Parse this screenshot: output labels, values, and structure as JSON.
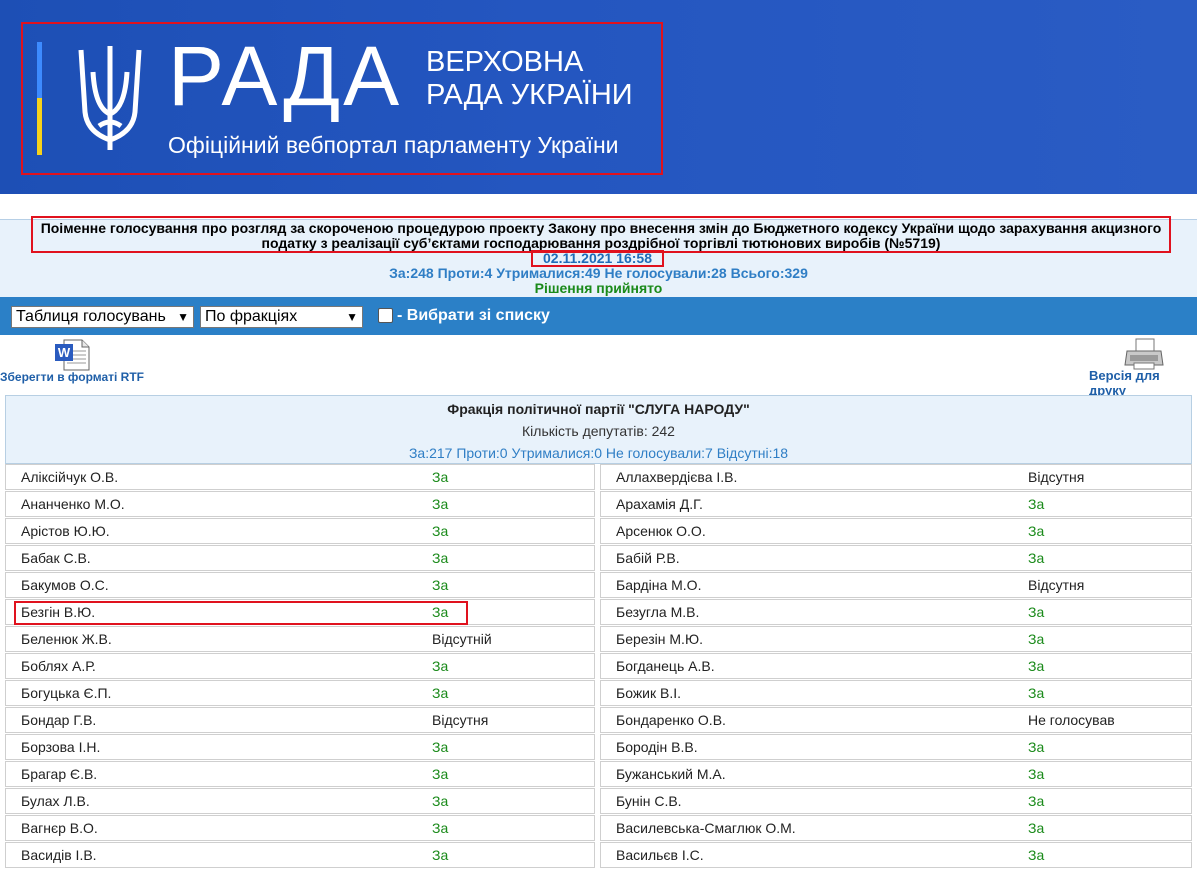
{
  "header": {
    "logo_word": "РАДА",
    "org_line1": "ВЕРХОВНА",
    "org_line2": "РАДА УКРАЇНИ",
    "portal_title": "Офіційний вебпортал парламенту України"
  },
  "vote": {
    "title": "Поіменне голосування про розгляд за скороченою процедурою проекту Закону про внесення змін до Бюджетного кодексу України щодо зарахування акцизного податку з реалізації суб’єктами господарювання роздрібної торгівлі тютюнових виробів (№5719)",
    "datetime": "02.11.2021 16:58",
    "summary": "За:248 Проти:4 Утрималися:49 Не голосували:28 Всього:329",
    "decision": "Рішення прийнято"
  },
  "toolbar": {
    "view_select": "Таблиця голосувань",
    "group_select": "По фракціях",
    "choose_label": "- Вибрати зі списку"
  },
  "actions": {
    "rtf_label": "Зберегти в форматі RTF",
    "print_label": "Версія для друку"
  },
  "faction": {
    "name": "Фракція політичної партії \"СЛУГА НАРОДУ\"",
    "count": "Кількість депутатів: 242",
    "summary": "За:217 Проти:0 Утрималися:0 Не голосували:7 Відсутні:18"
  },
  "left": [
    {
      "name": "Аліксійчук О.В.",
      "vote": "За"
    },
    {
      "name": "Ананченко М.О.",
      "vote": "За"
    },
    {
      "name": "Арістов Ю.Ю.",
      "vote": "За"
    },
    {
      "name": "Бабак С.В.",
      "vote": "За"
    },
    {
      "name": "Бакумов О.С.",
      "vote": "За"
    },
    {
      "name": "Безгін В.Ю.",
      "vote": "За"
    },
    {
      "name": "Беленюк Ж.В.",
      "vote": "Відсутній"
    },
    {
      "name": "Боблях А.Р.",
      "vote": "За"
    },
    {
      "name": "Богуцька Є.П.",
      "vote": "За"
    },
    {
      "name": "Бондар Г.В.",
      "vote": "Відсутня"
    },
    {
      "name": "Борзова І.Н.",
      "vote": "За"
    },
    {
      "name": "Брагар Є.В.",
      "vote": "За"
    },
    {
      "name": "Булах Л.В.",
      "vote": "За"
    },
    {
      "name": "Вагнєр В.О.",
      "vote": "За"
    },
    {
      "name": "Васидів І.В.",
      "vote": "За"
    }
  ],
  "right": [
    {
      "name": "Аллахвердієва І.В.",
      "vote": "Відсутня"
    },
    {
      "name": "Арахамія Д.Г.",
      "vote": "За"
    },
    {
      "name": "Арсенюк О.О.",
      "vote": "За"
    },
    {
      "name": "Бабій Р.В.",
      "vote": "За"
    },
    {
      "name": "Бардіна М.О.",
      "vote": "Відсутня"
    },
    {
      "name": "Безугла М.В.",
      "vote": "За"
    },
    {
      "name": "Березін М.Ю.",
      "vote": "За"
    },
    {
      "name": "Богданець А.В.",
      "vote": "За"
    },
    {
      "name": "Божик В.І.",
      "vote": "За"
    },
    {
      "name": "Бондаренко О.В.",
      "vote": "Не голосував"
    },
    {
      "name": "Бородін В.В.",
      "vote": "За"
    },
    {
      "name": "Бужанський М.А.",
      "vote": "За"
    },
    {
      "name": "Бунін С.В.",
      "vote": "За"
    },
    {
      "name": "Василевська-Смаглюк О.М.",
      "vote": "За"
    },
    {
      "name": "Васильєв І.С.",
      "vote": "За"
    }
  ],
  "colors": {
    "banner": "#2456c0",
    "highlight": "#e0121e",
    "vote_for": "#1a8a1a",
    "link": "#1f5fa8"
  }
}
